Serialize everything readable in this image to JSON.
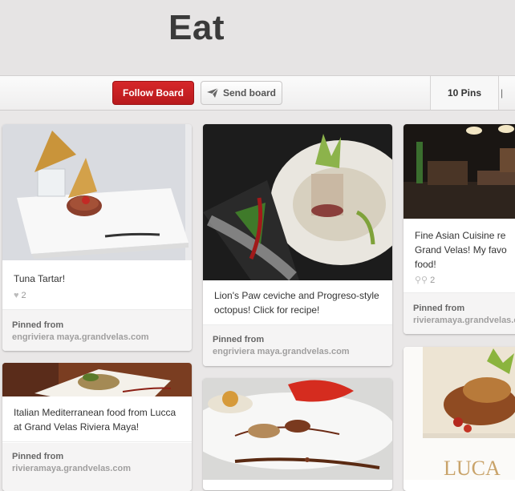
{
  "board": {
    "title": "Eat"
  },
  "toolbar": {
    "follow_label": "Follow Board",
    "send_label": "Send board",
    "pins_label": "10 Pins"
  },
  "pins": [
    {
      "description": "Tuna Tartar!",
      "likes": "2",
      "pinned_from_label": "Pinned from",
      "source": "engriviera maya.grandvelas.com"
    },
    {
      "description": "Lion's Paw ceviche and Progreso-style octopus! Click for recipe!",
      "pinned_from_label": "Pinned from",
      "source": "engriviera maya.grandvelas.com"
    },
    {
      "description": "Fine Asian Cuisine re Grand Velas! My favo food!",
      "repins": "2",
      "pinned_from_label": "Pinned from",
      "source": "rivieramaya.grandvelas.com"
    },
    {
      "description": "Italian Mediterranean food from Lucca at Grand Velas Riviera Maya!",
      "pinned_from_label": "Pinned from",
      "source": "rivieramaya.grandvelas.com"
    }
  ],
  "colors": {
    "follow": "#c8171b",
    "background": "#e9e7e7"
  }
}
